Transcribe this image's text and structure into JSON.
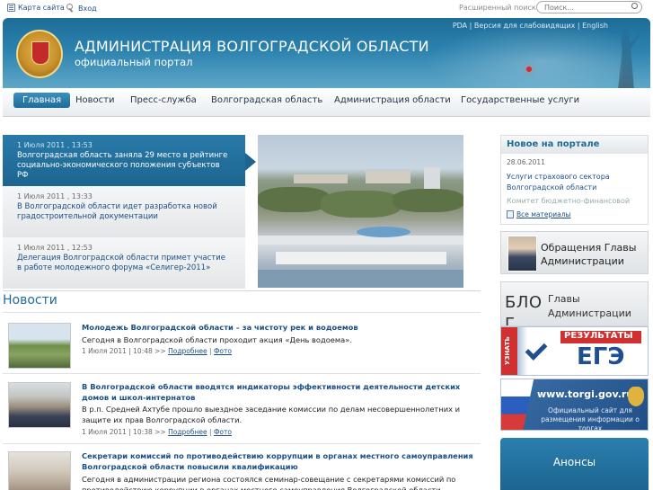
{
  "topbar": {
    "sitemap_label": "Карта сайта",
    "login_label": "Вход",
    "advanced_search_label": "Расширенный поиск",
    "search_placeholder": "Поиск..."
  },
  "header": {
    "title": "АДМИНИСТРАЦИЯ ВОЛГОГРАДСКОЙ ОБЛАСТИ",
    "subtitle": "официальный портал",
    "versions": "PDA | Версия для слабовидящих | English"
  },
  "nav": {
    "items": [
      {
        "label": "Главная"
      },
      {
        "label": "Новости"
      },
      {
        "label": "Пресс-служба"
      },
      {
        "label": "Волгоградская область"
      },
      {
        "label": "Администрация области"
      },
      {
        "label": "Государственные услуги"
      }
    ]
  },
  "slider": {
    "items": [
      {
        "date": "1 Июля 2011 , 13:53",
        "title": "Волгоградская область заняла 29 место в рейтинге социально-экономического положения субъектов РФ"
      },
      {
        "date": "1 Июля 2011 , 13:33",
        "title": "В Волгоградской области идет разработка новой градостроительной документации"
      },
      {
        "date": "1 Июля 2011 , 12:53",
        "title": "Делегация Волгоградской области примет участие в работе молодежного форума «Селигер-2011»"
      }
    ]
  },
  "news": {
    "heading": "Новости",
    "items": [
      {
        "title": "Молодежь Волгоградской области – за чистоту рек и водоемов",
        "text": "Сегодня в Волгоградской области проходит акция «День водоема».",
        "meta_prefix": "1 Июля 2011 | 10:48 >> ",
        "more": "Подробнее",
        "photo": "Фото"
      },
      {
        "title": "В Волгоградской области вводятся индикаторы эффективности деятельности детских домов и школ-интернатов",
        "text": "В р.п. Средней Ахтубе прошло выездное заседание комиссии по делам несовершеннолетних и защите их прав Волгоградской области.",
        "meta_prefix": "1 Июля 2011 | 10:38 >> ",
        "more": "Подробнее",
        "photo": "Фото"
      },
      {
        "title": "Секретари комиссий по противодействию коррупции в органах местного самоуправления Волгоградской области повысили квалификацию",
        "text": "Сегодня в администрации региона состоялся семинар-совещание с секретарями комиссий по противодействию коррупции в органах местного самоуправления Волгоградской области.",
        "meta_prefix": "",
        "more": "",
        "photo": ""
      }
    ]
  },
  "sidebar": {
    "new_portal": {
      "heading": "Новое на портале",
      "date": "28.06.2011",
      "item": "Услуги страхового сектора Волгоградской области",
      "faded": "Комитет бюджетно-финансовой",
      "all_label": "Все материалы"
    },
    "appeal": {
      "line1": "Обращения Главы",
      "line2": "Администрации"
    },
    "blog": {
      "big": "БЛО",
      "big2": "Г",
      "line1": "Главы",
      "line2": "Администрации"
    },
    "ege": {
      "side": "УЗНАТЬ",
      "results": "РЕЗУЛЬТАТЫ",
      "word": "ЕГЭ"
    },
    "torgi": {
      "url": "www.torgi.gov.ru",
      "desc": "Официальный сайт для размещения информации о торгах"
    },
    "anons": {
      "heading": "Анонсы"
    }
  },
  "colors": {
    "primary": "#1e6c98",
    "link": "#1a4f86",
    "accent_red": "#d0302f"
  }
}
